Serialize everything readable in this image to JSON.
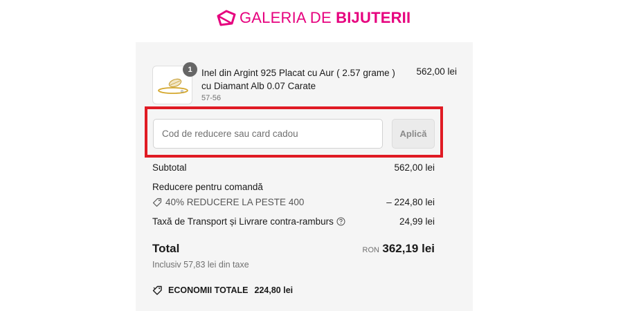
{
  "brand": {
    "logo_part1": "GALERIA DE ",
    "logo_part2": "BIJUTERII",
    "color": "#e6007e"
  },
  "product": {
    "name": "Inel din Argint 925 Placat cu Aur ( 2.57 grame ) cu Diamant Alb 0.07 Carate",
    "variant": "57-56",
    "price": "562,00 lei",
    "quantity": "1",
    "image_icon": "ring-thumbnail"
  },
  "discount": {
    "placeholder": "Cod de reducere sau card cadou",
    "apply_label": "Aplică",
    "highlight_color": "#e01b24"
  },
  "summary": {
    "subtotal_label": "Subtotal",
    "subtotal_value": "562,00 lei",
    "discount_label": "Reducere pentru comandă",
    "discount_code": "40% REDUCERE LA PESTE 400",
    "discount_value": "– 224,80 lei",
    "shipping_label": "Taxă de Transport și Livrare contra-ramburs",
    "shipping_value": "24,99 lei"
  },
  "total": {
    "label": "Total",
    "currency": "RON",
    "amount": "362,19 lei",
    "tax_note": "Inclusiv 57,83 lei din taxe"
  },
  "savings": {
    "label": "ECONOMII TOTALE",
    "amount": "224,80 lei"
  }
}
